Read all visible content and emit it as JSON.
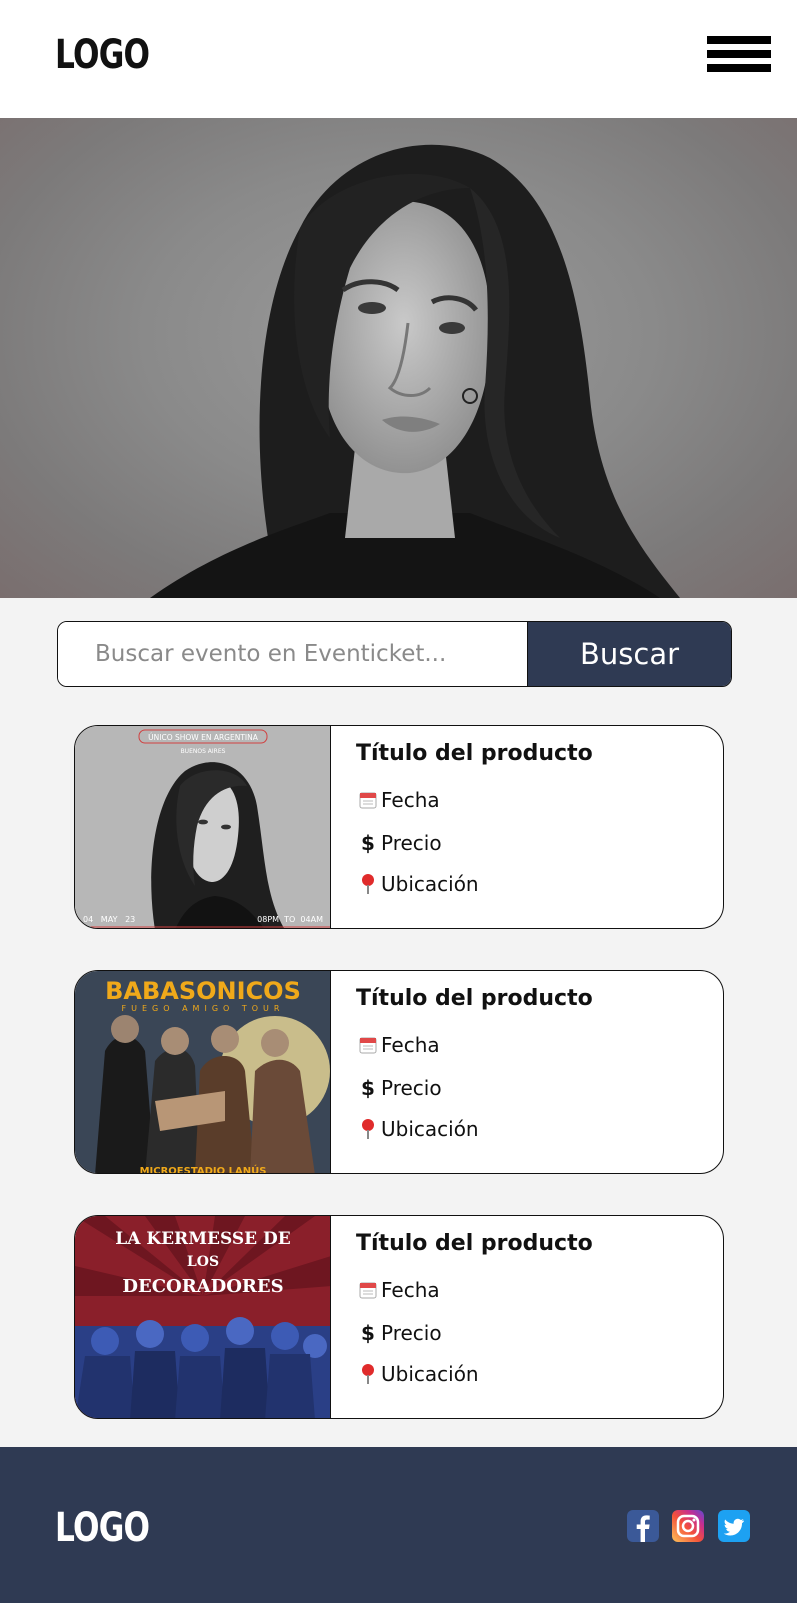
{
  "header": {
    "logo": "LOGO",
    "menu_icon": "hamburger-menu-icon"
  },
  "hero": {
    "image": "portrait-photo"
  },
  "search": {
    "placeholder": "Buscar evento en Eventicket...",
    "button_label": "Buscar"
  },
  "cards": [
    {
      "title": "Título del producto",
      "date_label": "Fecha",
      "price_label": "Precio",
      "location_label": "Ubicación",
      "poster": {
        "top_badge": "ÚNICO SHOW EN ARGENTINA",
        "subtitle": "BUENOS AIRES",
        "bottom_left": "04   MAY   23",
        "bottom_right": "08PM  TO  04AM"
      }
    },
    {
      "title": "Título del producto",
      "date_label": "Fecha",
      "price_label": "Precio",
      "location_label": "Ubicación",
      "poster": {
        "headline": "BABASONICOS",
        "subtitle": "FUEGO AMIGO TOUR",
        "bottom": "MICROESTADIO LANÚS"
      }
    },
    {
      "title": "Título del producto",
      "date_label": "Fecha",
      "price_label": "Precio",
      "location_label": "Ubicación",
      "poster": {
        "line1": "LA KERMESSE DE",
        "line2": "LOS",
        "line3": "DECORADORES"
      }
    }
  ],
  "icons": {
    "date": "calendar-icon",
    "price": "dollar-icon",
    "location": "pin-icon"
  },
  "footer": {
    "logo": "LOGO",
    "social": [
      "facebook-icon",
      "instagram-icon",
      "twitter-icon"
    ]
  },
  "colors": {
    "navy": "#2f3a53",
    "page_bg": "#f3f3f3"
  }
}
